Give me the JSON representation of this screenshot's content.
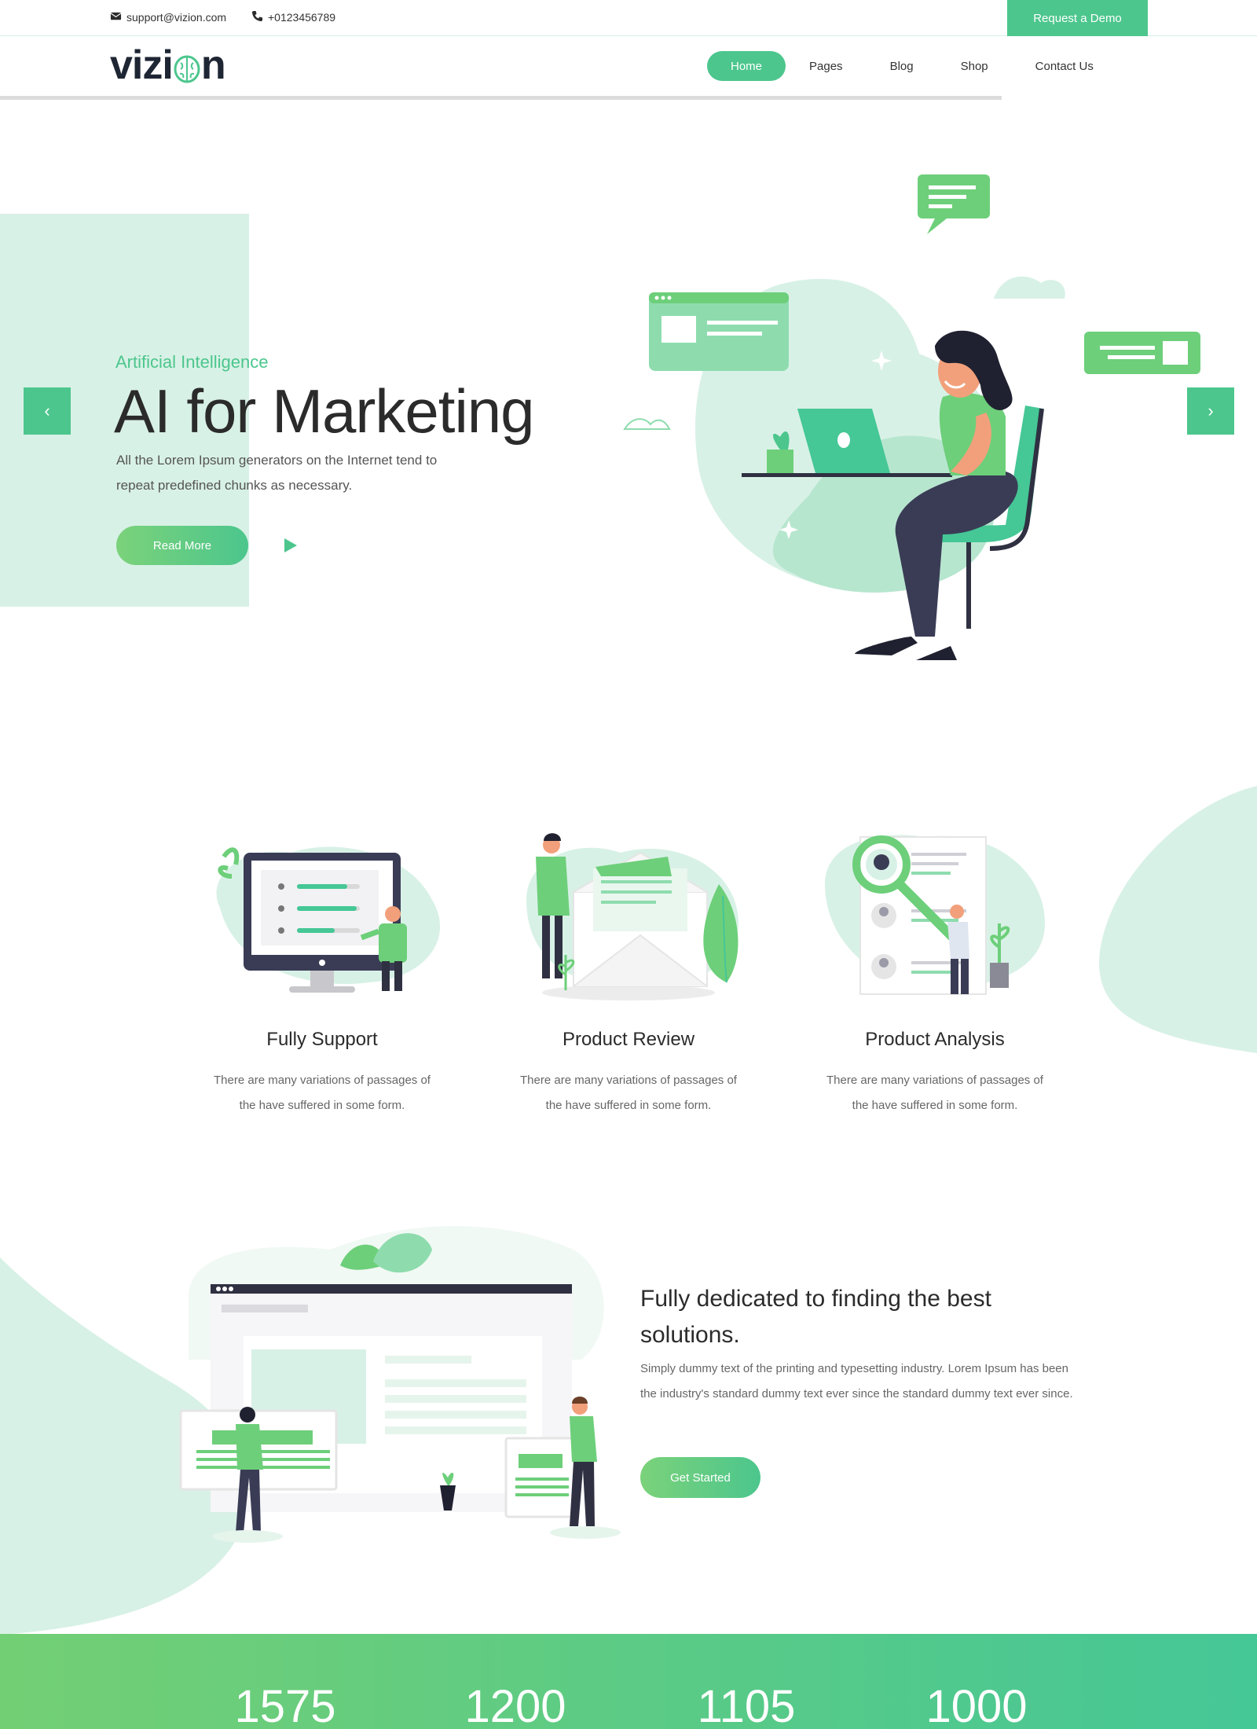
{
  "topbar": {
    "email": "support@vizion.com",
    "phone": "+0123456789",
    "demo_button": "Request a Demo"
  },
  "header": {
    "logo_left": "vizi",
    "logo_right": "n",
    "nav": [
      {
        "label": "Home",
        "active": true
      },
      {
        "label": "Pages",
        "active": false
      },
      {
        "label": "Blog",
        "active": false
      },
      {
        "label": "Shop",
        "active": false
      },
      {
        "label": "Contact Us",
        "active": false
      }
    ]
  },
  "hero": {
    "subtitle": "Artificial Intelligence",
    "title": "AI for Marketing",
    "description": "All the Lorem Ipsum generators on the Internet tend to repeat predefined chunks as necessary.",
    "read_more": "Read More",
    "prev_arrow": "‹",
    "next_arrow": "›"
  },
  "features": [
    {
      "title": "Fully Support",
      "text": "There are many variations of passages of the have suffered in some form."
    },
    {
      "title": "Product Review",
      "text": "There are many variations of passages of the have suffered in some form."
    },
    {
      "title": "Product Analysis",
      "text": "There are many variations of passages of the have suffered in some form."
    }
  ],
  "dedicated": {
    "title": "Fully dedicated to finding the best solutions.",
    "text": "Simply dummy text of the printing and typesetting industry. Lorem Ipsum has been the industry's standard dummy text ever since the standard dummy text ever since.",
    "button": "Get Started"
  },
  "stats": [
    "1575",
    "1200",
    "1105",
    "1000"
  ],
  "colors": {
    "accent": "#4cc68d",
    "accent_light": "#d8f1e6",
    "dark": "#1e2533"
  },
  "icons": [
    "envelope-icon",
    "phone-icon",
    "brain-icon",
    "play-icon",
    "chevron-left-icon",
    "chevron-right-icon"
  ]
}
